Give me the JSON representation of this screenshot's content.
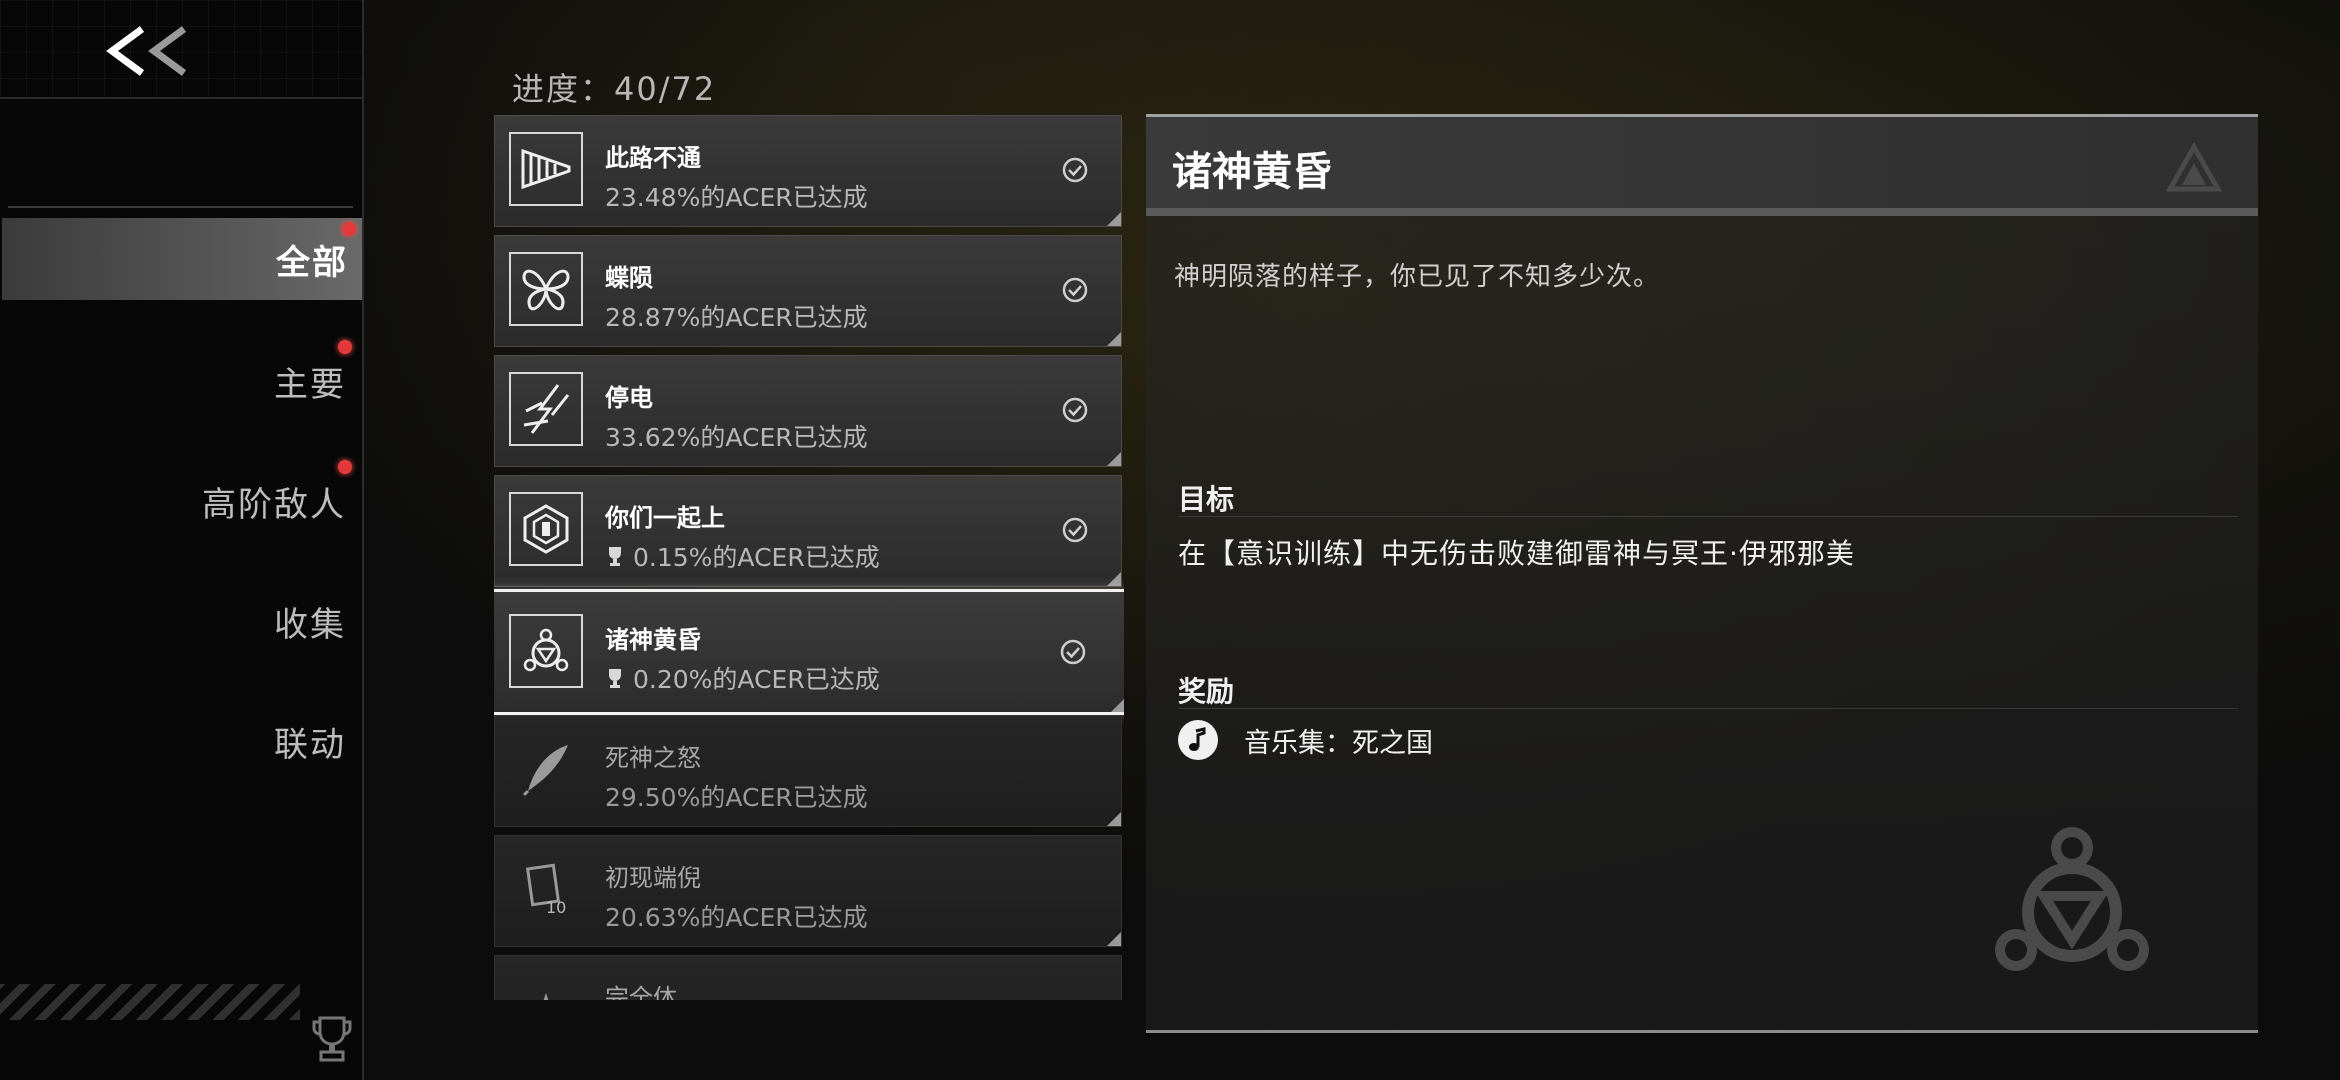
{
  "sidebar": {
    "back_label": "<<",
    "items": [
      {
        "label": "全部",
        "active": true,
        "dot": true
      },
      {
        "label": "主要",
        "active": false,
        "dot": true
      },
      {
        "label": "高阶敌人",
        "active": false,
        "dot": true
      },
      {
        "label": "收集",
        "active": false,
        "dot": false
      },
      {
        "label": "联动",
        "active": false,
        "dot": false
      }
    ]
  },
  "progress": {
    "label": "进度：40/72"
  },
  "achievements": [
    {
      "title": "此路不通",
      "rate": "23.48%的ACER已达成",
      "icon": "drill-icon",
      "trophy": false,
      "done": true
    },
    {
      "title": "蝶陨",
      "rate": "28.87%的ACER已达成",
      "icon": "butterfly-icon",
      "trophy": false,
      "done": true
    },
    {
      "title": "停电",
      "rate": "33.62%的ACER已达成",
      "icon": "lightning-icon",
      "trophy": false,
      "done": true
    },
    {
      "title": "你们一起上",
      "rate": "0.15%的ACER已达成",
      "icon": "hexagon-badge-icon",
      "trophy": true,
      "done": true
    },
    {
      "title": "诸神黄昏",
      "rate": "0.20%的ACER已达成",
      "icon": "emblem-icon",
      "trophy": true,
      "done": true,
      "selected": true
    },
    {
      "title": "死神之怒",
      "rate": "29.50%的ACER已达成",
      "icon": "feather-icon",
      "trophy": false,
      "done": false
    },
    {
      "title": "初现端倪",
      "rate": "20.63%的ACER已达成",
      "icon": "card-icon",
      "trophy": false,
      "done": false
    },
    {
      "title": "完全体",
      "rate": "",
      "icon": "star-icon",
      "trophy": false,
      "done": false
    }
  ],
  "detail": {
    "title": "诸神黄昏",
    "description": "神明陨落的样子，你已见了不知多少次。",
    "goal_label": "目标",
    "goal_text": "在【意识训练】中无伤击败建御雷神与冥王·伊邪那美",
    "reward_label": "奖励",
    "reward_text": "音乐集：死之国"
  },
  "colors": {
    "accent_dot": "#e23a3a",
    "selected_border": "#f2f2f2"
  }
}
